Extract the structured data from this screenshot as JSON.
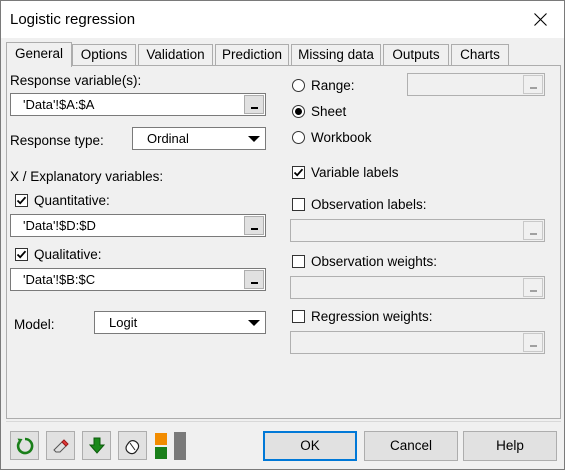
{
  "window": {
    "title": "Logistic regression"
  },
  "tabs": [
    "General",
    "Options",
    "Validation",
    "Prediction",
    "Missing data",
    "Outputs",
    "Charts"
  ],
  "left": {
    "response_label": "Response variable(s):",
    "response_value": "'Data'!$A:$A",
    "response_type_label": "Response type:",
    "response_type_value": "Ordinal",
    "explanatory_label": "X / Explanatory variables:",
    "quantitative_label": "Quantitative:",
    "quantitative_checked": true,
    "quantitative_value": "'Data'!$D:$D",
    "qualitative_label": "Qualitative:",
    "qualitative_checked": true,
    "qualitative_value": "'Data'!$B:$C",
    "model_label": "Model:",
    "model_value": "Logit"
  },
  "right": {
    "range_label": "Range:",
    "sheet_label": "Sheet",
    "workbook_label": "Workbook",
    "selected_scope": "Sheet",
    "variable_labels_label": "Variable labels",
    "variable_labels_checked": true,
    "observation_labels_label": "Observation labels:",
    "observation_labels_checked": false,
    "observation_weights_label": "Observation weights:",
    "observation_weights_checked": false,
    "regression_weights_label": "Regression weights:",
    "regression_weights_checked": false
  },
  "toolbar_icons": [
    "reset-icon",
    "eraser-icon",
    "download-arrow-icon",
    "mouse-icon",
    "layout-toggle-icon"
  ],
  "buttons": {
    "ok": "OK",
    "cancel": "Cancel",
    "help": "Help"
  },
  "colors": {
    "accent": "#0078d7",
    "green": "#1a7f1a",
    "orange": "#f28c00"
  }
}
